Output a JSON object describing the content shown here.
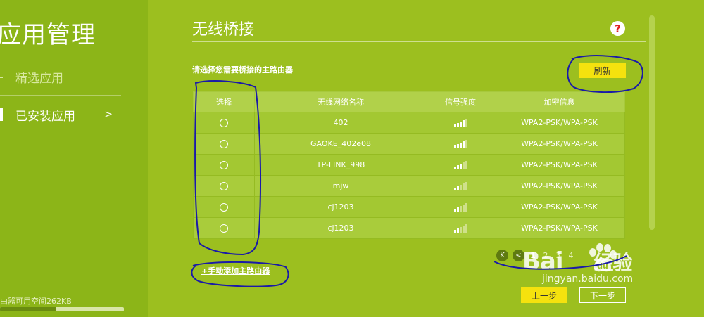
{
  "sidebar": {
    "app_title": "应用管理",
    "items": [
      {
        "label": "精选应用"
      },
      {
        "label": "已安装应用",
        "arrow": ">"
      }
    ],
    "storage_text": "由器可用空间262KB",
    "storage_used_fraction": 0.45
  },
  "panel": {
    "title": "无线桥接",
    "help_label": "?",
    "instruction": "请选择您需要桥接的主路由器",
    "refresh_label": "刷新"
  },
  "table": {
    "headers": [
      "选择",
      "无线网络名称",
      "信号强度",
      "加密信息"
    ],
    "rows": [
      {
        "ssid": "402",
        "signal_level": 4,
        "security": "WPA2-PSK/WPA-PSK"
      },
      {
        "ssid": "GAOKE_402e08",
        "signal_level": 4,
        "security": "WPA2-PSK/WPA-PSK"
      },
      {
        "ssid": "TP-LINK_998",
        "signal_level": 3,
        "security": "WPA2-PSK/WPA-PSK"
      },
      {
        "ssid": "mjw",
        "signal_level": 2,
        "security": "WPA2-PSK/WPA-PSK"
      },
      {
        "ssid": "cj1203",
        "signal_level": 2,
        "security": "WPA2-PSK/WPA-PSK"
      },
      {
        "ssid": "cj1203",
        "signal_level": 2,
        "security": "WPA2-PSK/WPA-PSK"
      }
    ]
  },
  "pagination": {
    "first_label": "K",
    "prev_label": "<",
    "pages": [
      "1",
      "2",
      "3",
      "4"
    ],
    "current_page": "1"
  },
  "manual_add_label": "+手动添加主路由器",
  "footer": {
    "prev_label": "上一步",
    "next_label": "下一步"
  },
  "watermark": {
    "logo_text": "Bai",
    "brand_cn": "经验",
    "url": "jingyan.baidu.com"
  },
  "colors": {
    "background": "#9cbf1f",
    "sidebar": "#8cb518",
    "accent_button": "#f5e20e",
    "help_icon": "#e02020",
    "annotation_ink": "#1a1aa8"
  }
}
